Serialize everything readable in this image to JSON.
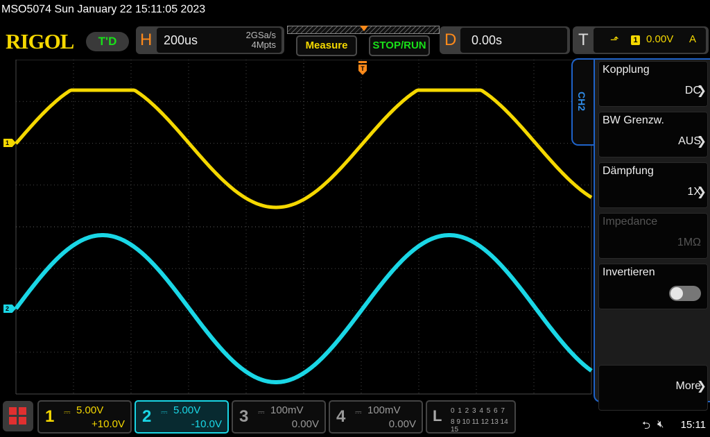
{
  "window": {
    "title": "MSO5074  Sun January 22 15:11:05 2023"
  },
  "brand": {
    "logo": "RIGOL",
    "status_pill": "T'D"
  },
  "horizontal": {
    "letter": "H",
    "timebase": "200us",
    "sample_rate": "2GSa/s",
    "memory_depth": "4Mpts"
  },
  "buttons": {
    "measure": "Measure",
    "stop_run": "STOP/RUN"
  },
  "delay": {
    "letter": "D",
    "value": "0.00s"
  },
  "trigger": {
    "letter": "T",
    "source": "1",
    "level": "0.00V",
    "mode": "A",
    "edge_icon": "rising-edge-icon"
  },
  "side_menu": {
    "tab_label": "CH2",
    "items": [
      {
        "title": "Kopplung",
        "value": "DC"
      },
      {
        "title": "BW Grenzw.",
        "value": "AUS"
      },
      {
        "title": "Dämpfung",
        "value": "1X"
      },
      {
        "title": "Impedance",
        "value": "1MΩ",
        "disabled": true
      },
      {
        "title": "Invertieren",
        "toggle": false
      },
      {
        "title": "",
        "value": "More"
      }
    ]
  },
  "channels": [
    {
      "num": "1",
      "scale": "5.00V",
      "offset": "+10.0V",
      "color": "#f5d800"
    },
    {
      "num": "2",
      "scale": "5.00V",
      "offset": "-10.0V",
      "color": "#1ad7e6"
    },
    {
      "num": "3",
      "scale": "100mV",
      "offset": "0.00V",
      "color": "#999999"
    },
    {
      "num": "4",
      "scale": "100mV",
      "offset": "0.00V",
      "color": "#999999"
    }
  ],
  "logic": {
    "letter": "L",
    "row1": "0 1 2 3  4 5 6 7",
    "row2": "8 9 10 11 12 13 14 15"
  },
  "markers": {
    "ch1": "1",
    "ch2": "2",
    "trigger": "T"
  },
  "status": {
    "time": "15:11"
  },
  "colors": {
    "ch1": "#f5d800",
    "ch2": "#1ad7e6",
    "accent": "#ff8a1a",
    "run_green": "#19e019",
    "panel_border": "#1f63c9"
  }
}
